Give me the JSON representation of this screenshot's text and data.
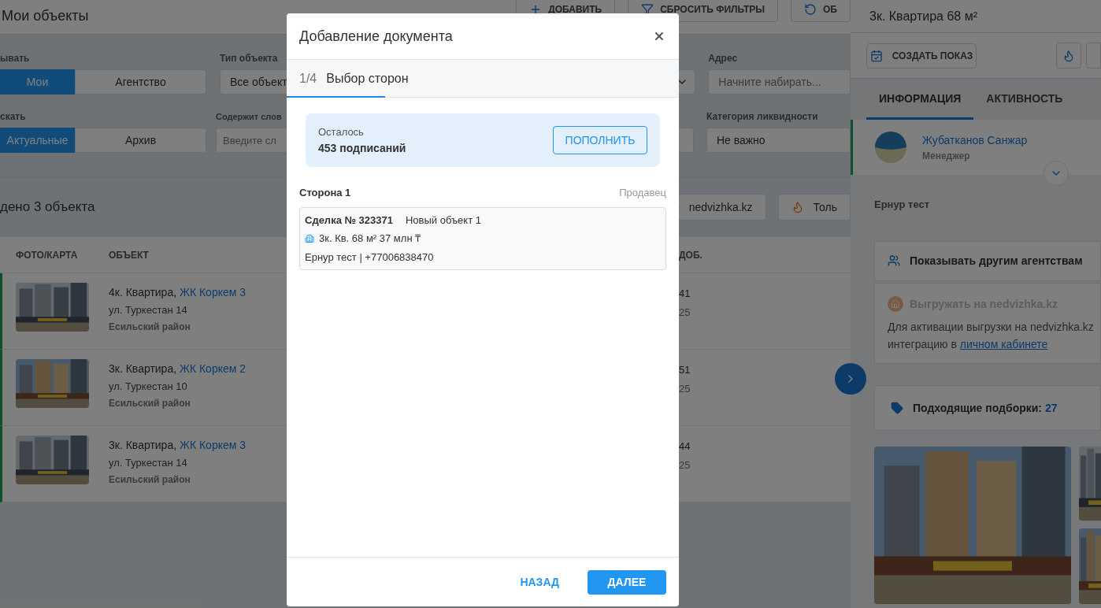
{
  "page": {
    "title": "Мои объекты",
    "actions": [
      {
        "label": "ДОБАВИТЬ",
        "kind": "add"
      },
      {
        "label": "СБРОСИТЬ ФИЛЬТРЫ",
        "kind": "filter"
      },
      {
        "label": "ОБ",
        "kind": "refresh"
      }
    ]
  },
  "filters": {
    "show": {
      "label": "ывать",
      "options": [
        {
          "label": "Мои",
          "selected": true
        },
        {
          "label": "Агентство",
          "selected": false
        }
      ]
    },
    "object_type": {
      "label": "Тип объекта",
      "value": "Все объект"
    },
    "address": {
      "label": "Адрес",
      "placeholder": "Начните набирать..."
    },
    "search": {
      "label": "скать",
      "options": [
        {
          "label": "Актуальные",
          "selected": true
        },
        {
          "label": "Архив",
          "selected": false
        }
      ]
    },
    "keywords": {
      "label": "Содержит слов",
      "placeholder": "Введите сл"
    },
    "liquidity": {
      "label": "Категория ликвидности",
      "value": "Не важно"
    }
  },
  "results": {
    "count": "дено 3 объекта",
    "chips": [
      {
        "label": "nedvizhka.kz",
        "kind": "link"
      },
      {
        "label": "Толь",
        "kind": "fire"
      }
    ]
  },
  "table": {
    "columns": [
      "ФОТО/КАРТА",
      "ОБЪЕКТ",
      "ДОБ."
    ],
    "rows": [
      {
        "title": "4к. Квартира, ",
        "complex": "ЖК Коркем 3",
        "street": "ул. Туркестан 14",
        "district": "Есильский район",
        "column_3": [
          "41",
          "25"
        ]
      },
      {
        "title": "3к. Квартира, ",
        "complex": "ЖК Коркем 2",
        "street": "ул. Туркестан 10",
        "district": "Есильский район",
        "column_3": [
          "51",
          "25"
        ]
      },
      {
        "title": "3к. Квартира, ",
        "complex": "ЖК Коркем 3",
        "street": "ул. Туркестан 14",
        "district": "Есильский район",
        "column_3": [
          "44",
          "25"
        ]
      }
    ]
  },
  "drawer": {
    "title": "3к. Квартира 68 м²",
    "create_button": "СОЗДАТЬ ПОКАЗ",
    "tabs": [
      {
        "label": "ИНФОРМАЦИЯ",
        "selected": true
      },
      {
        "label": "АКТИВНОСТЬ",
        "selected": false
      }
    ],
    "manager": {
      "name": "Жубатканов Санжар",
      "role": "Менеджер"
    },
    "owner": "Ернур тест",
    "share": {
      "label": "Показывать другим агентствам"
    },
    "export": {
      "label": "Выгружать на nedvizhka.kz",
      "disabled": true,
      "lines": [
        "Для активации выгрузки на nedvizhka.kz",
        "интеграцию в "
      ],
      "link": "личном кабинете"
    },
    "selections": {
      "label": "Подходящие подборки: ",
      "count": "27"
    }
  },
  "modal": {
    "title": "Добавление документа",
    "step": "1/4",
    "step_title": "Выбор сторон",
    "level": 0.25,
    "balance": {
      "label": "Осталось",
      "value": "453 подписаний",
      "button": "ПОПОЛНИТЬ"
    },
    "parties": [
      {
        "title": "Сторона 1",
        "role": "Продавец",
        "deal": "Сделка № 323371",
        "object": "Новый объект 1",
        "summary": "3к. Кв. 68 м² 37 млн ₸",
        "contact": "Ернур тест | +77006838470"
      }
    ],
    "buttons": {
      "back": "НАЗАД",
      "next": "ДАЛЕЕ"
    }
  }
}
